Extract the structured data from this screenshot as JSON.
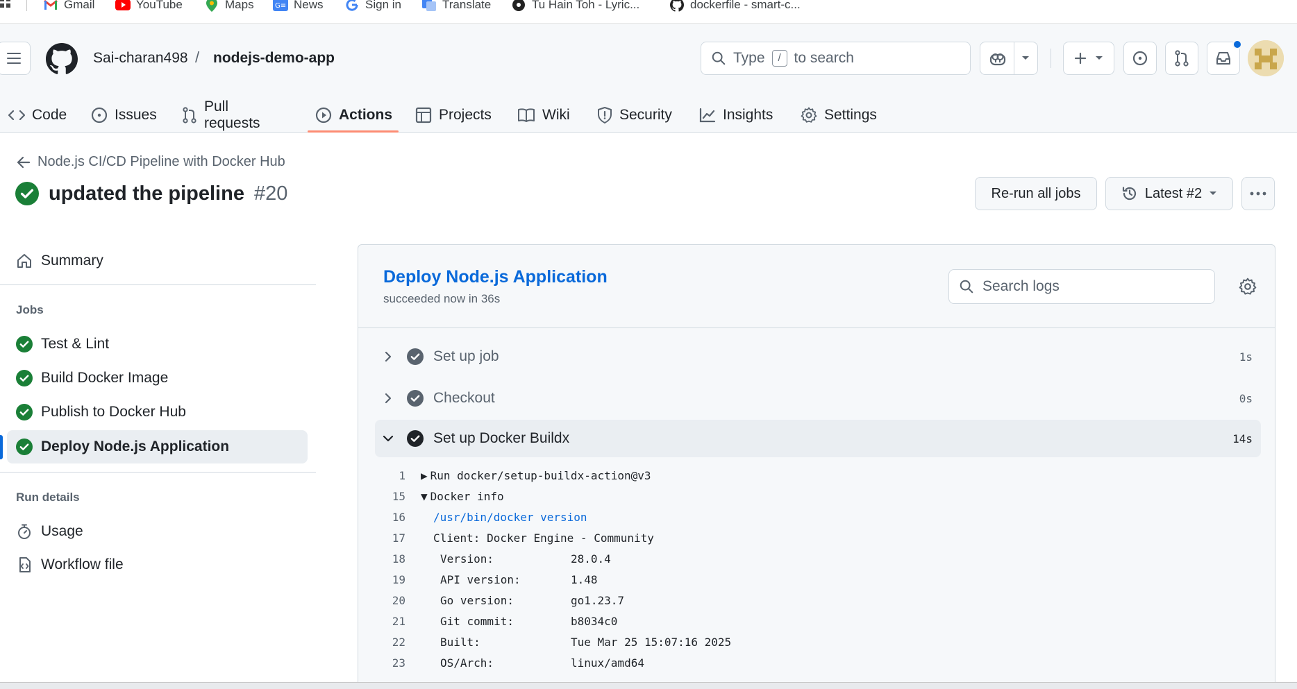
{
  "bookmarks": [
    {
      "label": "Gmail",
      "icon": "gmail-icon",
      "color": "#ea4335"
    },
    {
      "label": "YouTube",
      "icon": "youtube-icon",
      "color": "#ff0000"
    },
    {
      "label": "Maps",
      "icon": "maps-icon",
      "color": "#34a853"
    },
    {
      "label": "News",
      "icon": "news-icon",
      "color": "#4285f4"
    },
    {
      "label": "Sign in",
      "icon": "google-icon",
      "color": "#4285f4"
    },
    {
      "label": "Translate",
      "icon": "translate-icon",
      "color": "#4285f4"
    },
    {
      "label": "Tu Hain Toh - Lyric...",
      "icon": "music-icon",
      "color": "#222222"
    },
    {
      "label": "dockerfile - smart-c...",
      "icon": "github-icon",
      "color": "#222222"
    }
  ],
  "header": {
    "owner": "Sai-charan498",
    "separator": "/",
    "repo": "nodejs-demo-app",
    "search_prefix": "Type",
    "search_key": "/",
    "search_suffix": "to search"
  },
  "repo_nav": [
    {
      "label": "Code",
      "icon": "code-icon"
    },
    {
      "label": "Issues",
      "icon": "issue-icon"
    },
    {
      "label": "Pull requests",
      "icon": "pull-request-icon"
    },
    {
      "label": "Actions",
      "icon": "play-icon",
      "active": true
    },
    {
      "label": "Projects",
      "icon": "table-icon"
    },
    {
      "label": "Wiki",
      "icon": "book-icon"
    },
    {
      "label": "Security",
      "icon": "shield-icon"
    },
    {
      "label": "Insights",
      "icon": "graph-icon"
    },
    {
      "label": "Settings",
      "icon": "gear-icon"
    }
  ],
  "run": {
    "back_label": "Node.js CI/CD Pipeline with Docker Hub",
    "title": "updated the pipeline",
    "number": "#20",
    "rerun_label": "Re-run all jobs",
    "attempt_label": "Latest #2"
  },
  "sidebar": {
    "summary_label": "Summary",
    "jobs_heading": "Jobs",
    "jobs": [
      {
        "label": "Test & Lint",
        "status": "success"
      },
      {
        "label": "Build Docker Image",
        "status": "success"
      },
      {
        "label": "Publish to Docker Hub",
        "status": "success"
      },
      {
        "label": "Deploy Node.js Application",
        "status": "success",
        "active": true
      }
    ],
    "run_details_heading": "Run details",
    "usage_label": "Usage",
    "workflow_label": "Workflow file"
  },
  "job": {
    "name": "Deploy Node.js Application",
    "subtitle": "succeeded now in 36s",
    "search_placeholder": "Search logs",
    "steps": [
      {
        "label": "Set up job",
        "duration": "1s",
        "expanded": false
      },
      {
        "label": "Checkout",
        "duration": "0s",
        "expanded": false
      },
      {
        "label": "Set up Docker Buildx",
        "duration": "14s",
        "expanded": true
      }
    ],
    "log_lines": [
      {
        "n": "1",
        "marker": "▶",
        "text": "Run docker/setup-buildx-action@v3"
      },
      {
        "n": "15",
        "marker": "▼",
        "text": "Docker info"
      },
      {
        "n": "16",
        "text": "/usr/bin/docker version",
        "link": true
      },
      {
        "n": "17",
        "text": "Client: Docker Engine - Community"
      },
      {
        "n": "18",
        "key": "Version:",
        "value": "28.0.4"
      },
      {
        "n": "19",
        "key": "API version:",
        "value": "1.48"
      },
      {
        "n": "20",
        "key": "Go version:",
        "value": "go1.23.7"
      },
      {
        "n": "21",
        "key": "Git commit:",
        "value": "b8034c0"
      },
      {
        "n": "22",
        "key": "Built:",
        "value": "Tue Mar 25 15:07:16 2025"
      },
      {
        "n": "23",
        "key": "OS/Arch:",
        "value": "linux/amd64"
      }
    ]
  },
  "colors": {
    "success": "#1a7f37",
    "accent": "#0969da",
    "tab_underline": "#fd8c73"
  }
}
